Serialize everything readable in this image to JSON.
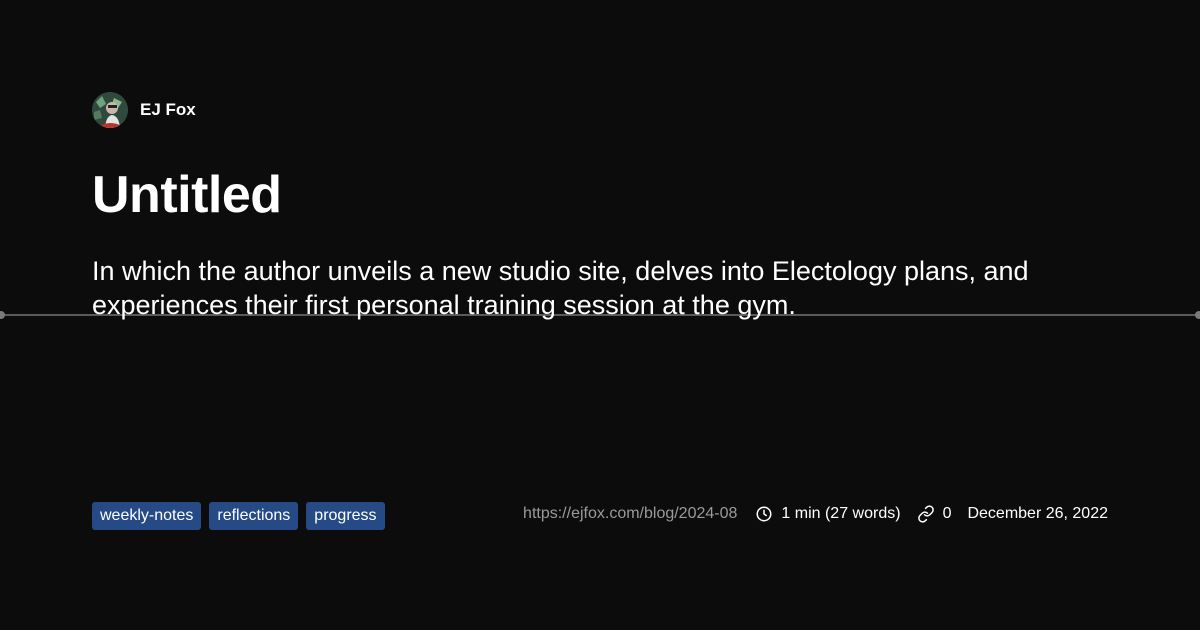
{
  "author": {
    "name": "EJ Fox"
  },
  "post": {
    "title": "Untitled",
    "description": "In which the author unveils a new studio site, delves into Electology plans, and experiences their first personal training session at the gym."
  },
  "tags": [
    "weekly-notes",
    "reflections",
    "progress"
  ],
  "meta": {
    "url": "https://ejfox.com/blog/2024-08",
    "reading_time": "1 min (27 words)",
    "links_count": "0",
    "date": "December 26, 2022"
  },
  "icons": {
    "reading_time": "clock-icon",
    "links": "link-icon"
  },
  "colors": {
    "background": "#0c0c0c",
    "tag_background": "#254a86",
    "divider": "#5a5a5a",
    "muted_text": "#9a9a9a"
  }
}
